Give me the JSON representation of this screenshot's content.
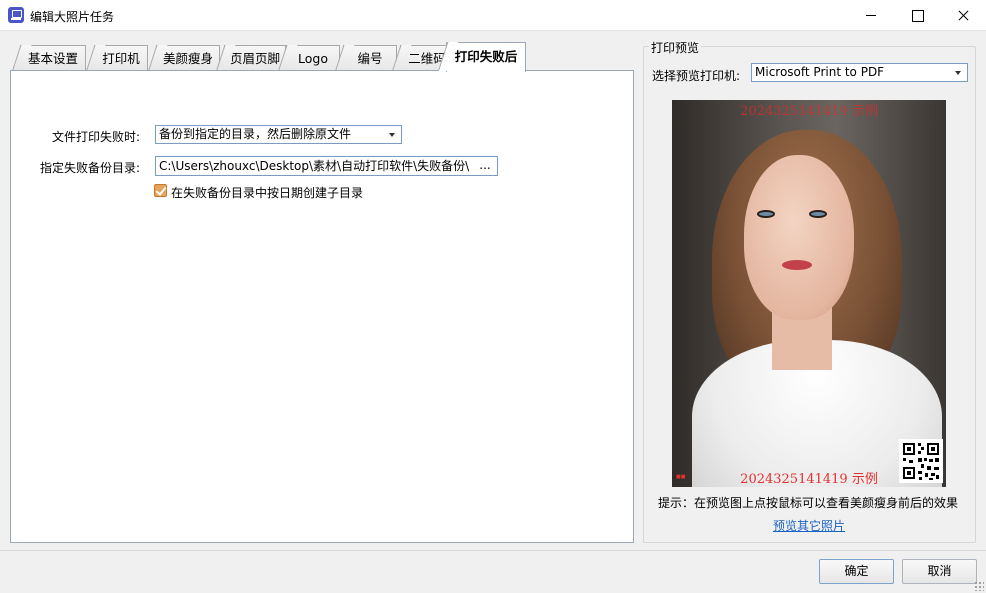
{
  "window": {
    "title": "编辑大照片任务",
    "icon": "app-printer-icon"
  },
  "tabs": [
    {
      "label": "基本设置"
    },
    {
      "label": "打印机"
    },
    {
      "label": "美颜瘦身"
    },
    {
      "label": "页眉页脚"
    },
    {
      "label": "Logo"
    },
    {
      "label": "编号"
    },
    {
      "label": "二维码"
    },
    {
      "label": "打印失败后",
      "active": true
    }
  ],
  "failure": {
    "action_label": "文件打印失败时:",
    "action_value": "备份到指定的目录，然后删除原文件",
    "backup_dir_label": "指定失败备份目录:",
    "backup_dir_value": "C:\\Users\\zhouxc\\Desktop\\素材\\自动打印软件\\失败备份\\",
    "browse_label": "...",
    "subdir_checkbox_label": "在失败备份目录中按日期创建子目录",
    "subdir_checked": true
  },
  "preview": {
    "group_title": "打印预览",
    "printer_label": "选择预览打印机:",
    "printer_value": "Microsoft Print to PDF",
    "stamp_top": "2024325141419  示例",
    "stamp_bottom": "2024325141419  示例",
    "hint": "提示：在预览图上点按鼠标可以查看美颜瘦身前后的效果",
    "link": "预览其它照片"
  },
  "footer": {
    "ok_label": "确定",
    "cancel_label": "取消"
  }
}
